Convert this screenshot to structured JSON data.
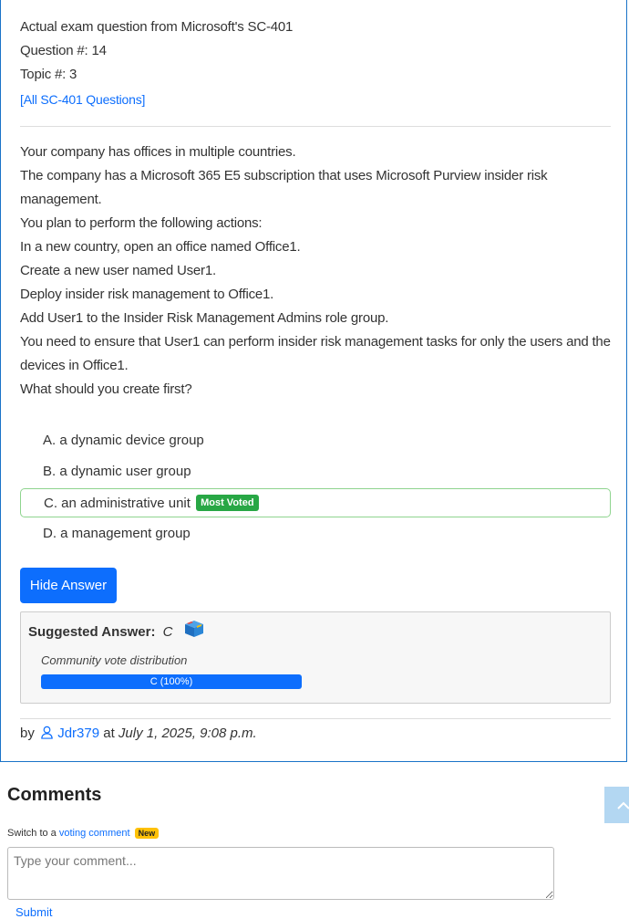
{
  "header": {
    "exam_line": "Actual exam question from Microsoft's SC-401",
    "question_number": "Question #: 14",
    "topic_number": "Topic #: 3",
    "all_questions_link": "[All SC-401 Questions]"
  },
  "question": {
    "lines": [
      "Your company has offices in multiple countries.",
      "The company has a Microsoft 365 E5 subscription that uses Microsoft Purview insider risk",
      "management.",
      "You plan to perform the following actions:",
      "In a new country, open an office named Office1.",
      "Create a new user named User1.",
      "Deploy insider risk management to Office1.",
      "Add User1 to the Insider Risk Management Admins role group.",
      "You need to ensure that User1 can perform insider risk management tasks for only the users and the",
      "devices in Office1.",
      "What should you create first?"
    ]
  },
  "choices": [
    {
      "text": "A. a dynamic device group"
    },
    {
      "text": "B. a dynamic user group"
    },
    {
      "text": "C. an administrative unit",
      "badge": "Most Voted"
    },
    {
      "text": "D. a management group"
    }
  ],
  "hide_answer_button": "Hide Answer",
  "suggested_answer": {
    "label": "Suggested Answer:",
    "value": "C",
    "icon": "cube-icon",
    "community_label": "Community vote distribution",
    "vote_bar_text": "C (100%)",
    "vote_percent": 100
  },
  "byline": {
    "by": "by",
    "user": "Jdr379",
    "at": "at",
    "date": "July 1, 2025, 9:08 p.m."
  },
  "comments": {
    "heading": "Comments",
    "switch_text": "Switch to a",
    "voting_link": "voting comment",
    "new_badge": "New",
    "placeholder": "Type your comment...",
    "submit": "Submit"
  },
  "colors": {
    "accent": "#0d6efd",
    "most_voted": "#28a745",
    "new_badge": "#ffc107"
  }
}
